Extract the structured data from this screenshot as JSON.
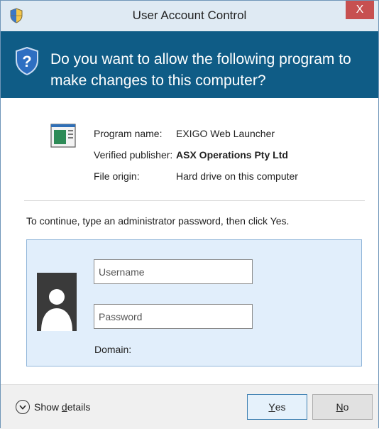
{
  "window": {
    "title": "User Account Control",
    "close_label": "X"
  },
  "header": {
    "question": "Do you want to allow the following program to make changes to this computer?"
  },
  "program": {
    "icon": "program-window-icon",
    "rows": [
      {
        "label": "Program name:",
        "value": "EXIGO Web Launcher"
      },
      {
        "label": "Verified publisher:",
        "value": "ASX Operations Pty Ltd"
      },
      {
        "label": "File origin:",
        "value": "Hard drive on this computer"
      }
    ]
  },
  "credentials": {
    "instruction": "To continue, type an administrator password, then click Yes.",
    "username_placeholder": "Username",
    "password_placeholder": "Password",
    "username_value": "",
    "password_value": "",
    "domain_label": "Domain:"
  },
  "footer": {
    "details_prefix": "Show ",
    "details_accel": "d",
    "details_suffix": "etails",
    "yes_accel": "Y",
    "yes_suffix": "es",
    "no_accel": "N",
    "no_suffix": "o"
  },
  "colors": {
    "banner": "#0f5c86",
    "titlebar": "#dfeaf3",
    "close_button": "#c75050",
    "credential_panel": "#e1eefb",
    "yes_button_border": "#3c7fb1"
  }
}
